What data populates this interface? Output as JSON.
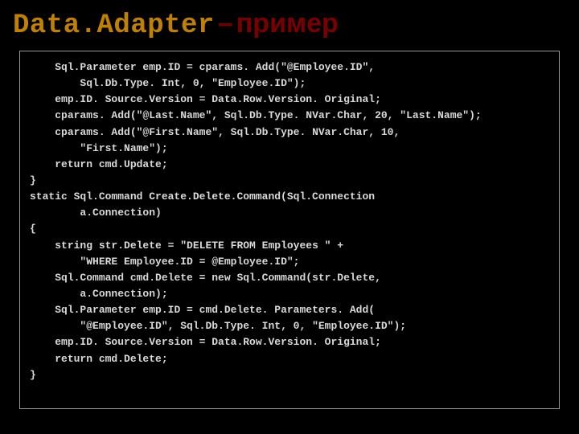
{
  "title": {
    "class_name": "Data.Adapter",
    "dash": "–",
    "suffix": "пример"
  },
  "code": {
    "lines": [
      "    Sql.Parameter emp.ID = cparams. Add(\"@Employee.ID\",",
      "        Sql.Db.Type. Int, 0, \"Employee.ID\");",
      "    emp.ID. Source.Version = Data.Row.Version. Original;",
      "    cparams. Add(\"@Last.Name\", Sql.Db.Type. NVar.Char, 20, \"Last.Name\");",
      "    cparams. Add(\"@First.Name\", Sql.Db.Type. NVar.Char, 10,",
      "        \"First.Name\");",
      "    return cmd.Update;",
      "}",
      "static Sql.Command Create.Delete.Command(Sql.Connection",
      "        a.Connection)",
      "{",
      "    string str.Delete = \"DELETE FROM Employees \" +",
      "        \"WHERE Employee.ID = @Employee.ID\";",
      "    Sql.Command cmd.Delete = new Sql.Command(str.Delete,",
      "        a.Connection);",
      "    Sql.Parameter emp.ID = cmd.Delete. Parameters. Add(",
      "        \"@Employee.ID\", Sql.Db.Type. Int, 0, \"Employee.ID\");",
      "    emp.ID. Source.Version = Data.Row.Version. Original;",
      "    return cmd.Delete;",
      "}"
    ]
  }
}
